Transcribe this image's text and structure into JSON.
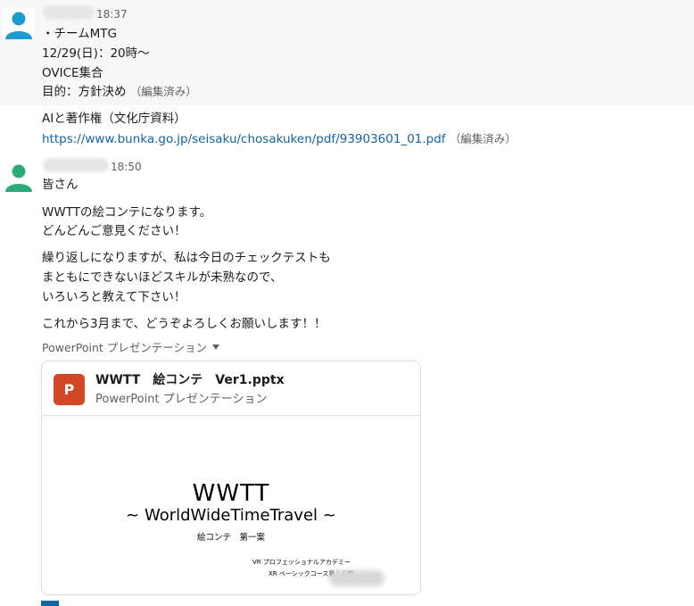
{
  "message1": {
    "time": "18:37",
    "lines": [
      "・チームMTG",
      "12/29(日)：20時～",
      "OVICE集合",
      "目的：方針決め"
    ],
    "edited_label": "（編集済み）"
  },
  "message1b": {
    "title": "AIと著作権（文化庁資料）",
    "url": "https://www.bunka.go.jp/seisaku/chosakuken/pdf/93903601_01.pdf",
    "edited_label": "（編集済み）"
  },
  "message2": {
    "time": "18:50",
    "lines": [
      "皆さん",
      "WWTTの絵コンテになります。",
      "どんどんご意見ください！",
      "繰り返しになりますが、私は今日のチェックテストも",
      "まともにできないほどスキルが未熟なので、",
      "いろいろと教えて下さい！",
      "これから3月まで、どうぞよろしくお願いします！！"
    ],
    "file_label": "PowerPoint プレゼンテーション",
    "file": {
      "icon_letter": "P",
      "name": "WWTT　絵コンテ　Ver1.pptx",
      "type": "PowerPoint プレゼンテーション",
      "preview": {
        "title": "WWTT",
        "subtitle": "~ WorldWideTimeTravel ~",
        "draft": "絵コンテ　第一案",
        "org_line1": "VR プロフェッショナルアカデミー",
        "org_line2": "XR ベーシックコース第１６期"
      }
    }
  },
  "colors": {
    "link": "#1264a3",
    "ppt_icon": "#d24726",
    "avatar1": "#1d9bd1",
    "avatar2": "#2bac76"
  },
  "icons": {
    "avatar1": "user-avatar-icon",
    "avatar2": "user-avatar-icon",
    "file_type": "powerpoint-icon",
    "caret": "caret-down-icon"
  }
}
